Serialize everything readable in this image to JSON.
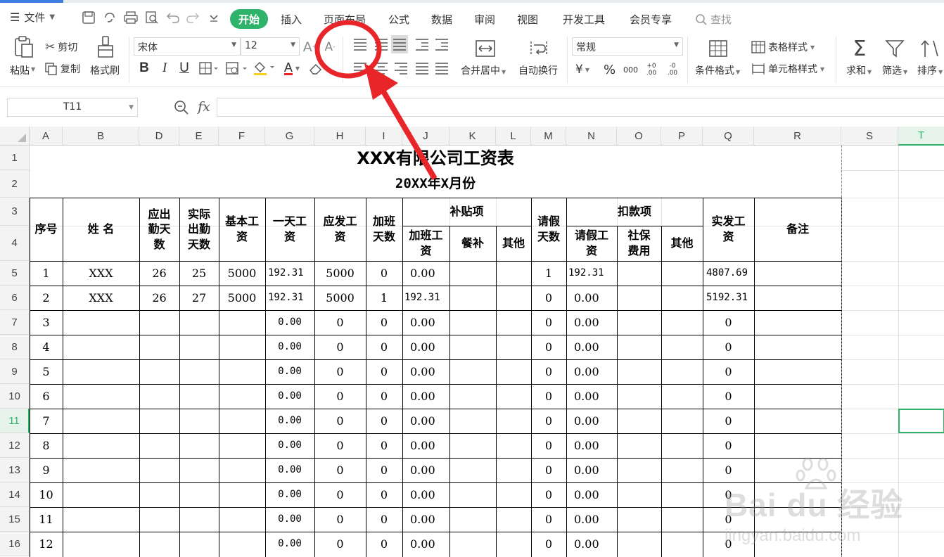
{
  "colors": {
    "accent": "#2fb26a",
    "annotation": "#e8262a",
    "header_bg": "#f3f3f3",
    "link_blue": "#3b7de0"
  },
  "menu": {
    "file_label": "文件",
    "tabs": [
      "插入",
      "页面布局",
      "公式",
      "数据",
      "审阅",
      "视图",
      "开发工具",
      "会员专享"
    ],
    "active_tab": "开始",
    "search_label": "查找",
    "quick_icons": [
      "save-icon",
      "format-painter-quick-icon",
      "print-icon",
      "print-preview-icon",
      "undo-icon",
      "redo-icon",
      "customize-icon"
    ]
  },
  "ribbon": {
    "paste": "粘贴",
    "cut": "剪切",
    "copy": "复制",
    "format_painter": "格式刷",
    "font_name": "宋体",
    "font_size": "12",
    "bold": "B",
    "italic": "I",
    "underline": "U",
    "font_color_letter": "A",
    "merge_center": "合并居中",
    "wrap_text": "自动换行",
    "number_format": "常规",
    "currency": "¥",
    "percent": "%",
    "thousands": "000",
    "dec_increase": "+0 .00",
    "dec_decrease": "-0 .00",
    "table_style": "表格样式",
    "conditional_format": "条件格式",
    "cell_style": "单元格样式",
    "sum": "求和",
    "filter": "筛选",
    "sort": "排序"
  },
  "formula_bar": {
    "name_box": "T11",
    "fx": "fx",
    "formula": ""
  },
  "columns": [
    "A",
    "B",
    "D",
    "E",
    "F",
    "G",
    "H",
    "I",
    "J",
    "K",
    "L",
    "M",
    "N",
    "O",
    "P",
    "Q",
    "R",
    "S",
    "T"
  ],
  "active_column": "T",
  "row_numbers": [
    "1",
    "2",
    "3",
    "4",
    "5",
    "6",
    "7",
    "8",
    "9",
    "10",
    "11",
    "12",
    "13",
    "14",
    "15",
    "16"
  ],
  "active_row": "11",
  "sheet": {
    "title": "XXX有限公司工资表",
    "subtitle": "20XX年X月份",
    "headers": {
      "seq": "序号",
      "name": "姓   名",
      "due_days": "应出\n勤天\n数",
      "actual_days": "实际\n出勤\n天数",
      "base_salary": "基本工\n资",
      "daily_wage": "一天工\n资",
      "gross": "应发工\n资",
      "ot_days": "加班\n天数",
      "allowance_group": "补贴项",
      "ot_pay": "加班工\n资",
      "meal": "餐补",
      "allow_other": "其他",
      "leave_days": "请假\n天数",
      "deduction_group": "扣款项",
      "leave_pay": "请假工\n资",
      "social_security": "社保\n费用",
      "deduct_other": "其他",
      "net_pay": "实发工\n资",
      "remarks": "备注"
    },
    "rows": [
      {
        "seq": "1",
        "name": "XXX",
        "due": "26",
        "actual": "25",
        "base": "5000",
        "daily": "192.31",
        "gross": "5000",
        "ot": "0",
        "ot_pay": "0.00",
        "leave": "1",
        "leave_pay": "192.31",
        "net": "4807.69"
      },
      {
        "seq": "2",
        "name": "XXX",
        "due": "26",
        "actual": "27",
        "base": "5000",
        "daily": "192.31",
        "gross": "5000",
        "ot": "1",
        "ot_pay": "192.31",
        "leave": "0",
        "leave_pay": "0.00",
        "net": "5192.31"
      },
      {
        "seq": "3",
        "name": "",
        "due": "",
        "actual": "",
        "base": "",
        "daily": "0.00",
        "gross": "0",
        "ot": "0",
        "ot_pay": "0.00",
        "leave": "0",
        "leave_pay": "0.00",
        "net": "0"
      },
      {
        "seq": "4",
        "name": "",
        "due": "",
        "actual": "",
        "base": "",
        "daily": "0.00",
        "gross": "0",
        "ot": "0",
        "ot_pay": "0.00",
        "leave": "0",
        "leave_pay": "0.00",
        "net": "0"
      },
      {
        "seq": "5",
        "name": "",
        "due": "",
        "actual": "",
        "base": "",
        "daily": "0.00",
        "gross": "0",
        "ot": "0",
        "ot_pay": "0.00",
        "leave": "0",
        "leave_pay": "0.00",
        "net": "0"
      },
      {
        "seq": "6",
        "name": "",
        "due": "",
        "actual": "",
        "base": "",
        "daily": "0.00",
        "gross": "0",
        "ot": "0",
        "ot_pay": "0.00",
        "leave": "0",
        "leave_pay": "0.00",
        "net": "0"
      },
      {
        "seq": "7",
        "name": "",
        "due": "",
        "actual": "",
        "base": "",
        "daily": "0.00",
        "gross": "0",
        "ot": "0",
        "ot_pay": "0.00",
        "leave": "0",
        "leave_pay": "0.00",
        "net": "0"
      },
      {
        "seq": "8",
        "name": "",
        "due": "",
        "actual": "",
        "base": "",
        "daily": "0.00",
        "gross": "0",
        "ot": "0",
        "ot_pay": "0.00",
        "leave": "0",
        "leave_pay": "0.00",
        "net": "0"
      },
      {
        "seq": "9",
        "name": "",
        "due": "",
        "actual": "",
        "base": "",
        "daily": "0.00",
        "gross": "0",
        "ot": "0",
        "ot_pay": "0.00",
        "leave": "0",
        "leave_pay": "0.00",
        "net": "0"
      },
      {
        "seq": "10",
        "name": "",
        "due": "",
        "actual": "",
        "base": "",
        "daily": "0.00",
        "gross": "0",
        "ot": "0",
        "ot_pay": "0.00",
        "leave": "0",
        "leave_pay": "0.00",
        "net": "0"
      },
      {
        "seq": "11",
        "name": "",
        "due": "",
        "actual": "",
        "base": "",
        "daily": "0.00",
        "gross": "0",
        "ot": "0",
        "ot_pay": "0.00",
        "leave": "0",
        "leave_pay": "0.00",
        "net": "0"
      },
      {
        "seq": "12",
        "name": "",
        "due": "",
        "actual": "",
        "base": "",
        "daily": "0.00",
        "gross": "0",
        "ot": "0",
        "ot_pay": "0.00",
        "leave": "0",
        "leave_pay": "0.00",
        "net": "0"
      }
    ]
  },
  "watermark": {
    "brand": "Bai du 经验",
    "url": "jingyan.baidu.com"
  }
}
